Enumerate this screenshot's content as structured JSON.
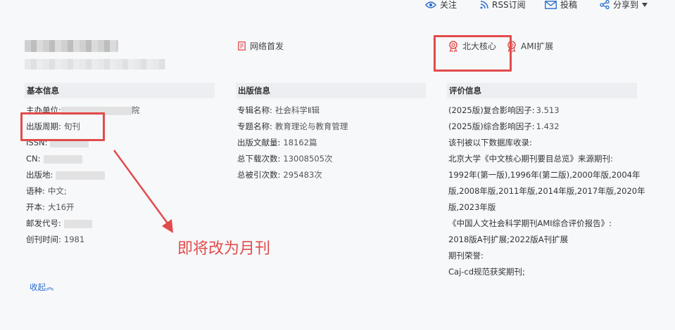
{
  "top_actions": {
    "follow": "关注",
    "rss": "RSS订阅",
    "contribute": "投稿",
    "share": "分享到"
  },
  "tags": {
    "network_first": "网络首发",
    "pku_core": "北大核心",
    "ami": "AMI扩展"
  },
  "basic": {
    "title": "基本信息",
    "sponsor_label": "主办单位:",
    "sponsor_tail": "院",
    "cycle_label": "出版周期:",
    "cycle_value": "旬刊",
    "issn_label": "ISSN:",
    "cn_label": "CN:",
    "place_label": "出版地:",
    "language_label": "语种:",
    "language_value": "中文;",
    "format_label": "开本:",
    "format_value": "大16开",
    "postal_label": "邮发代号:",
    "founded_label": "创刊时间:",
    "founded_value": "1981"
  },
  "pub": {
    "title": "出版信息",
    "series_label": "专辑名称:",
    "series_value": "社会科学Ⅱ辑",
    "topic_label": "专题名称:",
    "topic_value": "教育理论与教育管理",
    "docs_label": "出版文献量:",
    "docs_value": "18162篇",
    "downloads_label": "总下载次数:",
    "downloads_value": "13008505次",
    "citations_label": "总被引次数:",
    "citations_value": "295483次"
  },
  "eval": {
    "title": "评价信息",
    "composite_label": "(2025版)复合影响因子:",
    "composite_value": "3.513",
    "comprehensive_label": "(2025版)综合影响因子:",
    "comprehensive_value": "1.432",
    "db_intro": "该刊被以下数据库收录:",
    "pku_line": "北京大学《中文核心期刊要目总览》来源期刊:",
    "pku_years_1": "1992年(第一版),1996年(第二版),2000年版,2004年",
    "pku_years_2": "版,2008年版,2011年版,2014年版,2017年版,2020年",
    "pku_years_3": "版,2023年版",
    "ami_line": "《中国人文社会科学期刊AMI综合评价报告》:",
    "ami_years": "2018版A刊扩展;2022版A刊扩展",
    "honor_label": "期刊荣誉:",
    "honor_value": "Caj-cd规范获奖期刊;"
  },
  "collapse_label": "收起",
  "annotation_text": "即将改为月刊",
  "colors": {
    "highlight": "#e24b4b",
    "link": "#2a6ec9",
    "section_bg": "#eceef1"
  }
}
